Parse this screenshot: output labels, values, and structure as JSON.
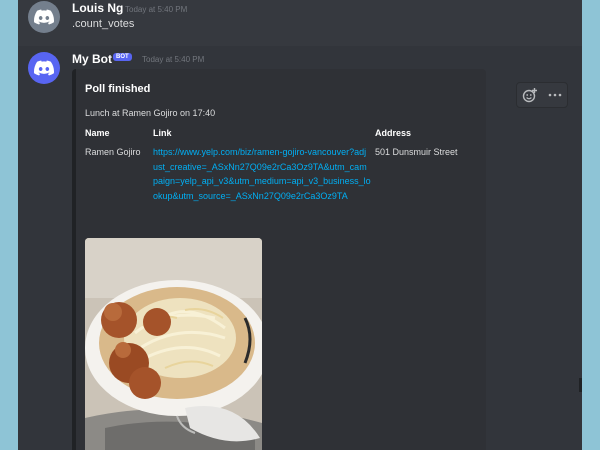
{
  "messages": [
    {
      "author": "Louis Ng",
      "timestamp": "Today at 5:40 PM",
      "content": ".count_votes"
    },
    {
      "author": "My Bot",
      "bot_tag": "BOT",
      "timestamp": "Today at 5:40 PM",
      "embed": {
        "title": "Poll finished",
        "description": "Lunch at Ramen Gojiro on 17:40",
        "fields": [
          {
            "name": "Name",
            "value": "Ramen Gojiro"
          },
          {
            "name": "Link",
            "value": "https://www.yelp.com/biz/ramen-gojiro-vancouver?adjust_creative=_ASxNn27Q09e2rCa3Oz9TA&utm_campaign=yelp_api_v3&utm_medium=api_v3_business_lookup&utm_source=_ASxNn27Q09e2rCa3Oz9TA"
          },
          {
            "name": "Address",
            "value": "501 Dunsmuir Street"
          }
        ],
        "image_alt": "ramen-bowl-photo"
      }
    }
  ],
  "toolbar": {
    "add_reaction_icon": "emoji-plus-icon",
    "more_icon": "ellipsis-icon"
  },
  "colors": {
    "background": "#36393f",
    "link": "#00aff4",
    "bot_tag": "#5865f2",
    "timestamp": "#72767d"
  }
}
